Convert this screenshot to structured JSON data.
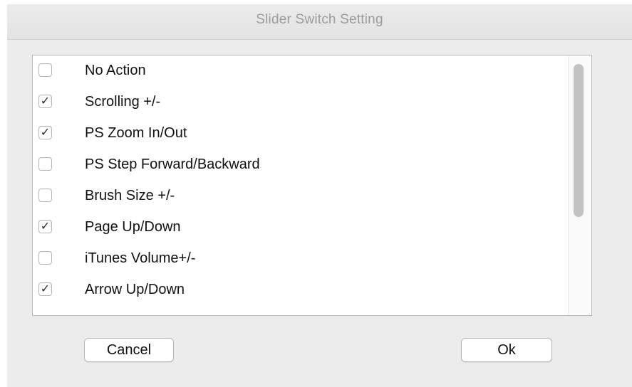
{
  "dialog": {
    "title": "Slider Switch Setting"
  },
  "options": [
    {
      "label": "No Action",
      "checked": false
    },
    {
      "label": "Scrolling +/-",
      "checked": true
    },
    {
      "label": "PS Zoom In/Out",
      "checked": true
    },
    {
      "label": "PS Step Forward/Backward",
      "checked": false
    },
    {
      "label": "Brush Size +/-",
      "checked": false
    },
    {
      "label": "Page Up/Down",
      "checked": true
    },
    {
      "label": "iTunes Volume+/-",
      "checked": false
    },
    {
      "label": "Arrow Up/Down",
      "checked": true
    }
  ],
  "icons": {
    "check_glyph": "✓"
  },
  "buttons": {
    "cancel_label": "Cancel",
    "ok_label": "Ok"
  }
}
